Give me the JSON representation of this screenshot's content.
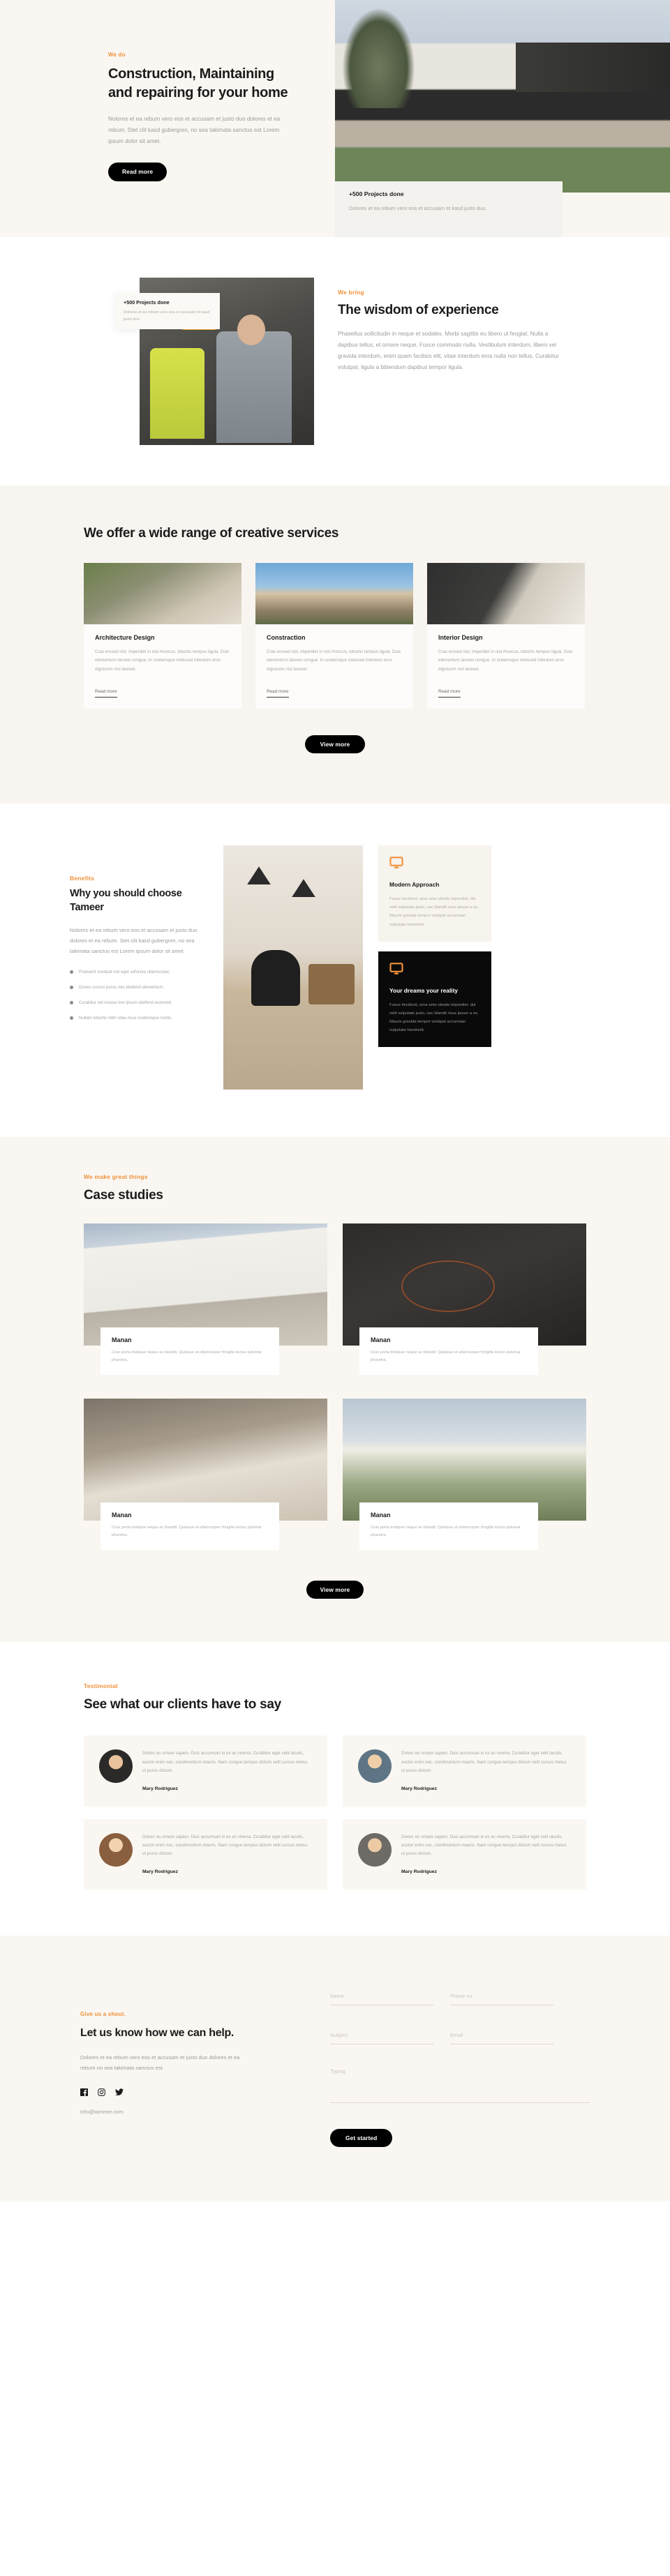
{
  "theme": {
    "accent": "#f0913a",
    "dark": "#0a0a0a",
    "cream": "#faf7f2",
    "muted": "#a8a49e"
  },
  "hero": {
    "eyebrow": "We do",
    "title": "Construction, Maintaining and repairing for your home",
    "body": "Nolores et ea rebum vero eos et accusam et justo duo dolores et ea rebum. Stet clit kasd gubergren, no sea takimata sanctus est Lorem ipsum dolor sit amet.",
    "cta": "Read more",
    "badge": {
      "title": "+500 Projects done",
      "text": "Dolores et ea rebum vero eos et accusam et kasd justo duo."
    }
  },
  "wisdom": {
    "eyebrow": "We bring",
    "title": "The wisdom of experience",
    "body": "Phasellus sollicitudin in neque et sodales. Morbi sagittis eu libero ut feugiat. Nulla a dapibus tellus, et ornare neque. Fusce commodo nulla. Vestibulum interdum, libero vel gravida interdum, enim quam facilisis elit, vitae interdum eros nulla non tellus. Curabitur volutpat, ligula a bibendum dapibus tempor ligula.",
    "badge": {
      "title": "+500 Projects done",
      "text": "Dolores et ea rebum vero eos et accusam et kasd justo duo."
    }
  },
  "services": {
    "title": "We offer a wide range of creative services",
    "cta": "View more",
    "cards": [
      {
        "title": "Architecture Design",
        "desc": "Cras erosed nisl, imperdiet in nisl rhoncus, lobortis tempus ligula. Duis elementum laoreet congue. In scelerisque metused interdum eros dignissim nisl laoreet.",
        "link": "Read more"
      },
      {
        "title": "Constraction",
        "desc": "Cras erosed nisl, imperdiet in nisl rhoncus, lobortis tempus ligula. Duis elementum laoreet congue. In scelerisque metused interdum eros dignissim nisl laoreet.",
        "link": "Read more"
      },
      {
        "title": "Interior Design",
        "desc": "Cras erosed nisl, imperdiet in nisl rhoncus, lobortis tempus ligula. Duis elementum laoreet congue. In scelerisque metused interdum eros dignissim nisl laoreet.",
        "link": "Read more"
      }
    ]
  },
  "benefits": {
    "eyebrow": "Benefits",
    "title": "Why you should choose Tameer",
    "body": "Nolores et ea rebum vero eos et accusam et justo duo dolores et ea rebum. Stet clit kasd gubergren, no sea takimata sanctus est Lorem ipsum dolor sit amet.",
    "bullets": [
      "Praesent volutpat nisl eget vehicula ullamcorper.",
      "Donec cursus purus nec eleifend elementum.",
      "Curabitur vel massa non ipsum eleifend euismod.",
      "Nullam lobortis nibh vitae risus scelerisque mollis."
    ],
    "cards": [
      {
        "icon": "monitor-icon",
        "title": "Modern Approach",
        "desc": "Fusce tincidunt, urna ame olestie imperdiet, dui velit vulputate justo, nec blandit risus ipsum a ex. Mauris gravida tempor volutpat accumsan vulputate  hendrerit."
      },
      {
        "icon": "monitor-icon",
        "title": "Your dreams your reality",
        "desc": "Fusce tincidunt, urna ame olestie imperdiet, dui velit vulputate justo, nec blandit risus ipsum a ex. Mauris gravida tempor volutpat accumsan vulputate  hendrerit."
      }
    ]
  },
  "cases": {
    "eyebrow": "We make great things",
    "title": "Case studies",
    "cta": "View more",
    "items": [
      {
        "title": "Manan",
        "desc": "Cras porta tristique neque ac blandit. Quisque ut ullamcorper fringilla lectus pulvinar pharetra."
      },
      {
        "title": "Manan",
        "desc": "Cras porta tristique neque ac blandit. Quisque ut ullamcorper fringilla lectus pulvinar pharetra."
      },
      {
        "title": "Manan",
        "desc": "Cras porta tristique neque ac blandit. Quisque ut ullamcorper fringilla lectus pulvinar pharetra."
      },
      {
        "title": "Manan",
        "desc": "Cras porta tristique neque ac blandit. Quisque ut ullamcorper fringilla lectus pulvinar pharetra."
      }
    ]
  },
  "testimonials": {
    "eyebrow": "Testimonial",
    "title": "See what our clients have to say",
    "items": [
      {
        "quote": "Donec eu ornare sapien. Duis accumsan in ex ac viverra. Curabitur eget velit iaculis, auctor enim nec, condimentum mauris. Nam congue tempus dictum velit cursus metus ut purus dictum.",
        "name": "Mary  Rodriguez"
      },
      {
        "quote": "Donec eu ornare sapien. Duis accumsan in ex ac viverra. Curabitur eget velit iaculis, auctor enim nec, condimentum mauris. Nam congue tempus dictum velit cursus metus ut purus dictum.",
        "name": "Mary  Rodriguez"
      },
      {
        "quote": "Donec eu ornare sapien. Duis accumsan in ex ac viverra. Curabitur eget velit iaculis, auctor enim nec, condimentum mauris. Nam congue tempus dictum velit cursus metus ut purus dictum.",
        "name": "Mary  Rodriguez"
      },
      {
        "quote": "Donec eu ornare sapien. Duis accumsan in ex ac viverra. Curabitur eget velit iaculis, auctor enim nec, condimentum mauris. Nam congue tempus dictum velit cursus metus ut purus dictum.",
        "name": "Mary  Rodriguez"
      }
    ]
  },
  "contact": {
    "eyebrow": "Give us a shout.",
    "title": "Let us know how we can help.",
    "body": "Dolores et ea rebum vero eos et accusam et justo duo dolores et ea rebum no sea takimata sanctus est.",
    "email": "info@tammer.com",
    "socials": [
      "facebook-icon",
      "instagram-icon",
      "twitter-icon"
    ],
    "form": {
      "name_placeholder": "Name",
      "phone_placeholder": "Phone no",
      "subject_placeholder": "Subject",
      "email_placeholder": "Email",
      "message_placeholder": "Typing",
      "name_value": "",
      "phone_value": "",
      "subject_value": "",
      "email_value": "",
      "message_value": "",
      "submit": "Get started"
    }
  }
}
